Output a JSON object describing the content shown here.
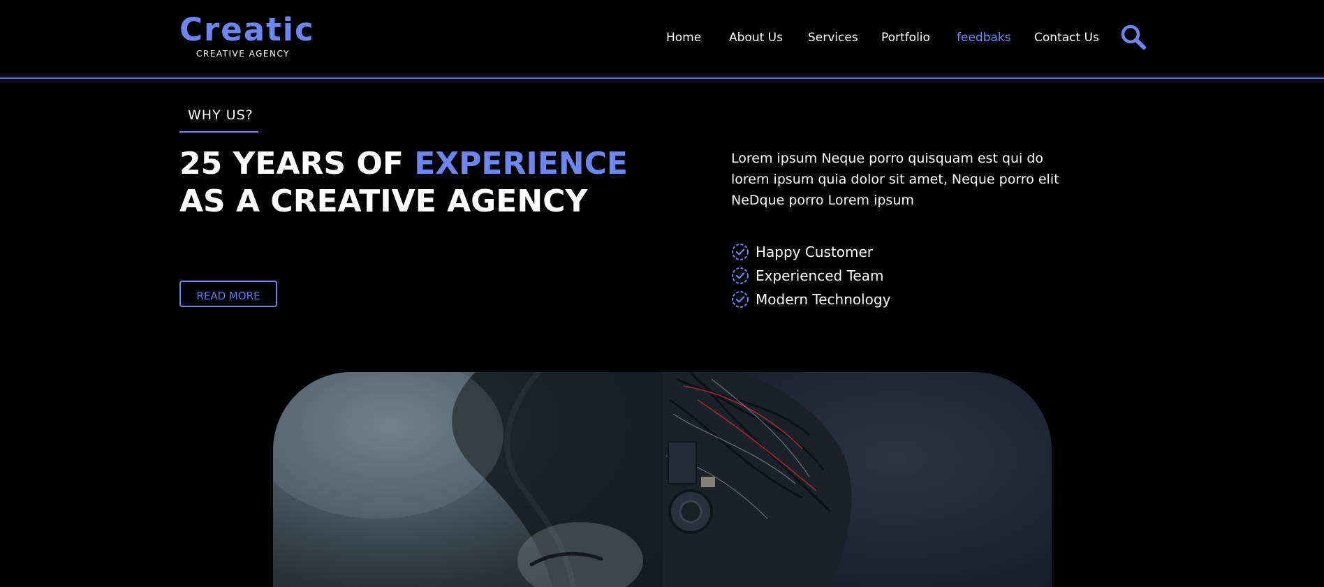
{
  "brand": {
    "name": "Creatic",
    "tagline": "CREATIVE AGENCY"
  },
  "nav": {
    "items": [
      {
        "label": "Home"
      },
      {
        "label": "About Us"
      },
      {
        "label": "Services"
      },
      {
        "label": "Portfolio"
      },
      {
        "label": "feedbaks",
        "active": true
      },
      {
        "label": "Contact Us"
      }
    ],
    "search_icon": "search-icon"
  },
  "why": {
    "eyebrow": "WHY US?",
    "headline_part1": "25 YEARS OF ",
    "headline_accent": "EXPERIENCE",
    "headline_line2": "AS A CREATIVE AGENCY",
    "button_label": "READ MORE",
    "description": "Lorem ipsum Neque porro quisquam est qui do lorem ipsum quia dolor sit amet, Neque porro elit NeDque porro Lorem ipsum",
    "features": [
      "Happy Customer",
      "Experienced Team",
      "Modern Technology"
    ]
  },
  "colors": {
    "accent": "#6e86f2",
    "background": "#000000",
    "divider": "#5d6cd6"
  }
}
